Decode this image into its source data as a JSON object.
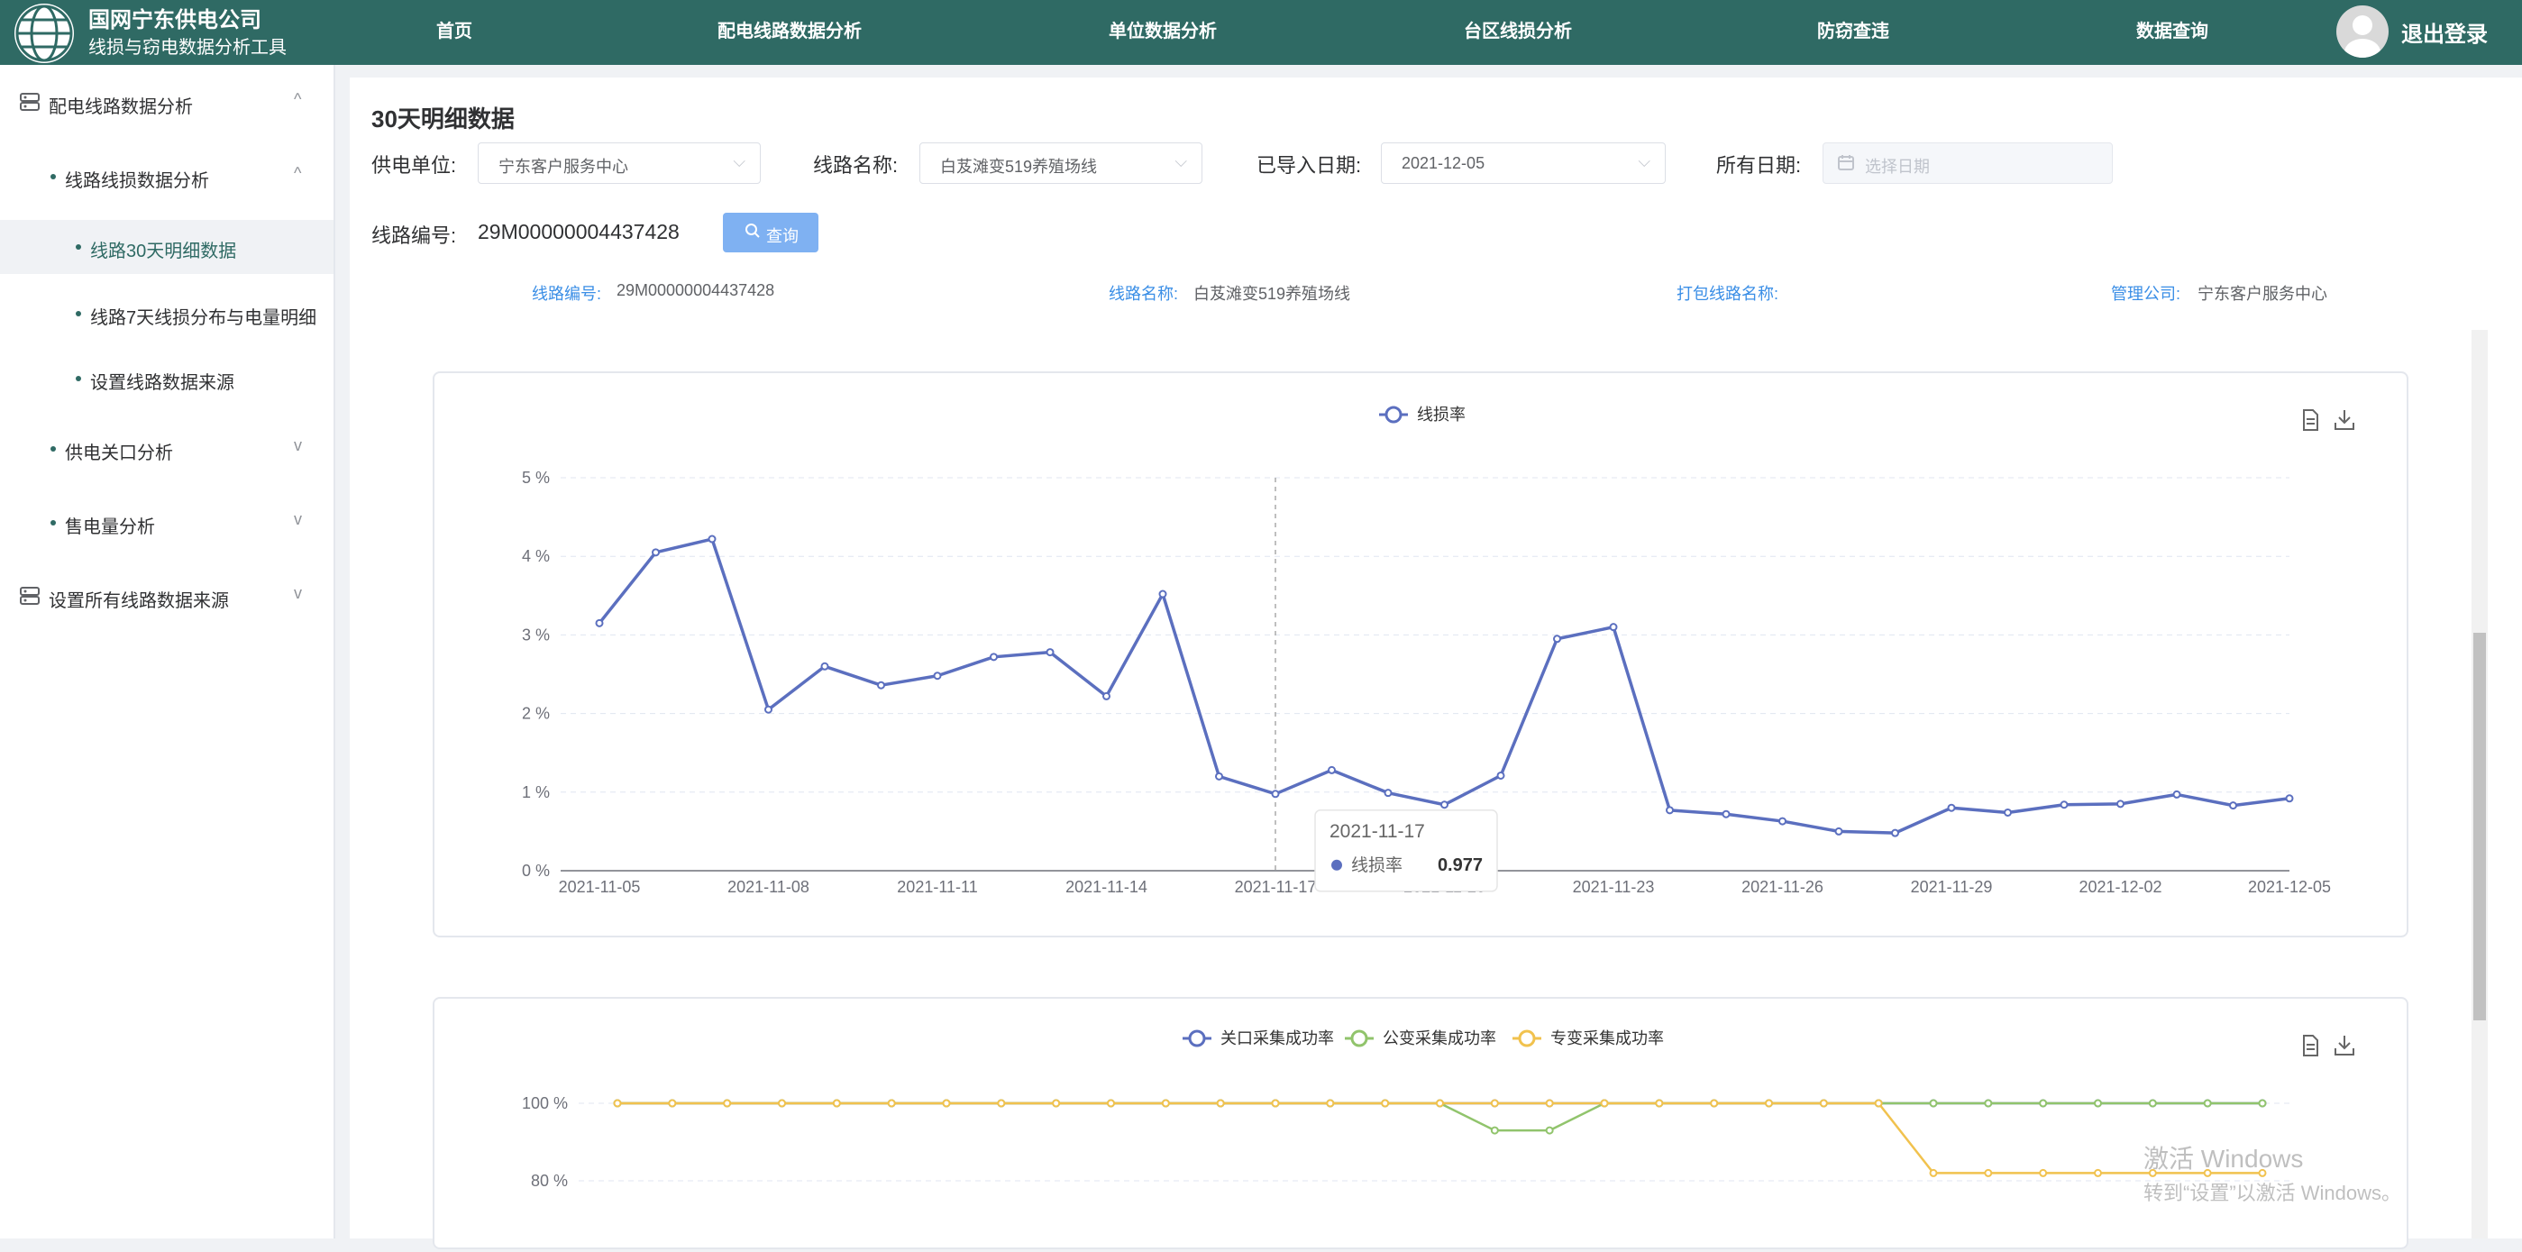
{
  "header": {
    "company": "国网宁东供电公司",
    "subtitle": "线损与窃电数据分析工具",
    "nav": [
      "首页",
      "配电线路数据分析",
      "单位数据分析",
      "台区线损分析",
      "防窃查违",
      "数据查询"
    ],
    "logout": "退出登录"
  },
  "sidebar": {
    "items": [
      {
        "label": "配电线路数据分析",
        "chevron": "^"
      },
      {
        "label": "线路线损数据分析",
        "chevron": "^"
      },
      {
        "label": "线路30天明细数据"
      },
      {
        "label": "线路7天线损分布与电量明细"
      },
      {
        "label": "设置线路数据来源"
      },
      {
        "label": "供电关口分析",
        "chevron": "v"
      },
      {
        "label": "售电量分析",
        "chevron": "v"
      },
      {
        "label": "设置所有线路数据来源",
        "chevron": "v"
      }
    ]
  },
  "main": {
    "title": "30天明细数据",
    "filters": {
      "unit_label": "供电单位:",
      "unit_value": "宁东客户服务中心",
      "line_label": "线路名称:",
      "line_value": "白芨滩变519养殖场线",
      "import_label": "已导入日期:",
      "import_value": "2021-12-05",
      "all_label": "所有日期:",
      "all_placeholder": "选择日期",
      "code_label": "线路编号:",
      "code_value": "29M00000004437428",
      "query_button": "查询"
    },
    "info": {
      "code_key": "线路编号:",
      "code_val": "29M00000004437428",
      "name_key": "线路名称:",
      "name_val": "白芨滩变519养殖场线",
      "pack_key": "打包线路名称:",
      "mgmt_key": "管理公司:",
      "mgmt_val": "宁东客户服务中心"
    }
  },
  "chart_data": [
    {
      "type": "line",
      "legend": [
        "线损率"
      ],
      "x": [
        "2021-11-05",
        "2021-11-06",
        "2021-11-07",
        "2021-11-08",
        "2021-11-09",
        "2021-11-10",
        "2021-11-11",
        "2021-11-12",
        "2021-11-13",
        "2021-11-14",
        "2021-11-15",
        "2021-11-16",
        "2021-11-17",
        "2021-11-18",
        "2021-11-19",
        "2021-11-20",
        "2021-11-21",
        "2021-11-22",
        "2021-11-23",
        "2021-11-24",
        "2021-11-25",
        "2021-11-26",
        "2021-11-27",
        "2021-11-28",
        "2021-11-29",
        "2021-11-30",
        "2021-12-01",
        "2021-12-02",
        "2021-12-03",
        "2021-12-04",
        "2021-12-05"
      ],
      "x_tick_labels": [
        "2021-11-05",
        "2021-11-08",
        "2021-11-11",
        "2021-11-14",
        "2021-11-17",
        "2021-11-20",
        "2021-11-23",
        "2021-11-26",
        "2021-11-29",
        "2021-12-02",
        "2021-12-05"
      ],
      "series": [
        {
          "name": "线损率",
          "color": "#5b6fbf",
          "values": [
            3.15,
            4.05,
            4.22,
            2.05,
            2.6,
            2.36,
            2.48,
            2.72,
            2.78,
            2.22,
            3.52,
            1.2,
            0.977,
            1.28,
            0.99,
            0.84,
            1.21,
            2.95,
            3.1,
            0.77,
            0.72,
            0.63,
            0.5,
            0.48,
            0.8,
            0.74,
            0.84,
            0.85,
            0.97,
            0.83,
            0.92
          ]
        }
      ],
      "y_ticks": [
        "0 %",
        "1 %",
        "2 %",
        "3 %",
        "4 %",
        "5 %"
      ],
      "ylim": [
        0,
        5
      ],
      "grid": true,
      "tooltip": {
        "date": "2021-11-17",
        "series": "线损率",
        "value": "0.977"
      }
    },
    {
      "type": "line",
      "legend": [
        "关口采集成功率",
        "公变采集成功率",
        "专变采集成功率"
      ],
      "series": [
        {
          "name": "关口采集成功率",
          "color": "#5b6fbf",
          "values": [
            100,
            100,
            100,
            100,
            100,
            100,
            100,
            100,
            100,
            100,
            100,
            100,
            100,
            100,
            100,
            100,
            100,
            100,
            100,
            100,
            100,
            100,
            100,
            100,
            100,
            100,
            100,
            100,
            100,
            100,
            100
          ]
        },
        {
          "name": "公变采集成功率",
          "color": "#91c46c",
          "values": [
            100,
            100,
            100,
            100,
            100,
            100,
            100,
            100,
            100,
            100,
            100,
            100,
            100,
            100,
            100,
            100,
            93,
            93,
            100,
            100,
            100,
            100,
            100,
            100,
            100,
            100,
            100,
            100,
            100,
            100,
            100
          ]
        },
        {
          "name": "专变采集成功率",
          "color": "#f1c24e",
          "values": [
            100,
            100,
            100,
            100,
            100,
            100,
            100,
            100,
            100,
            100,
            100,
            100,
            100,
            100,
            100,
            100,
            100,
            100,
            100,
            100,
            100,
            100,
            100,
            100,
            82,
            82,
            82,
            82,
            82,
            82,
            82
          ]
        }
      ],
      "y_ticks": [
        "100 %",
        "80 %"
      ],
      "grid": true
    }
  ],
  "watermark": {
    "line1": "激活 Windows",
    "line2": "转到“设置”以激活 Windows。"
  }
}
